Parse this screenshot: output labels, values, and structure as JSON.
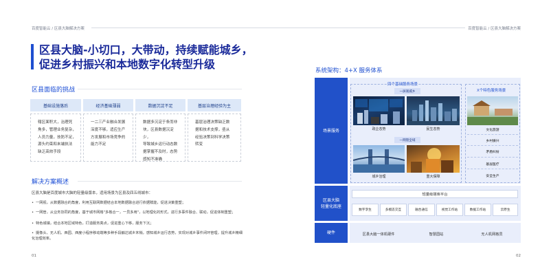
{
  "header": {
    "left": "百度智能云 / 区县大脑解决方案",
    "right": "百度智能云 / 区县大脑解决方案"
  },
  "title": {
    "line1": "区县大脑-小切口，大带动，持续赋能城乡，",
    "line2": "促进乡村振兴和本地数字化转型升级"
  },
  "challenges": {
    "title": "区县面临的挑战",
    "items": [
      {
        "head": "基础设施落后",
        "body": [
          "辖区面积大，治理死",
          "角多，管理业务复杂，",
          "人员力量，技防不足，",
          "源头约束和末端执法",
          "缺乏高效手段"
        ]
      },
      {
        "head": "经济基础薄弱",
        "body": [
          "一二三产业融合发展",
          "深度不够，适应生产",
          "方发展和市场竞争的",
          "能力不足"
        ]
      },
      {
        "head": "数据沉淀不足",
        "body": [
          "数据多沉淀于条而非",
          "块，区县数据沉淀少，",
          "导致城乡运行动态数",
          "据掌握不及时，态势",
          "感知不准确"
        ]
      },
      {
        "head": "基层治理经验为主",
        "body": [
          "基层治理决策缺乏数",
          "据和技术支撑，亟从",
          "经验决策到科学决策",
          "转变"
        ]
      }
    ]
  },
  "solution": {
    "title": "解决方案概述",
    "intro": "区县大脑是百度城市大脑的轻量级版本，适用场景为区县及四五线城市：",
    "bullets": [
      "一网视，从数据融合的角度，利用互联网数据结合本地数据融合进行依据赋能，促进决策重塑；",
      "一网管，从业务协同的角度，基于城市网格\"多格合一，一员多用\"，以地理化的形式，进行多事件融合、联动，促进体制重塑；",
      "特色城镇，结合本地区域特色，打造服务亮点，促进重心下移，服务下沉；",
      "摄像头、无人机、西园、西度小程序移动端等多种手段触达城乡末梢，感知城乡运行态势，实现对城乡事件闭环管理，提升城乡精细化治理效率。"
    ]
  },
  "page_numbers": {
    "left": "01",
    "right": "02"
  },
  "architecture": {
    "title": "系统架构：4+X 服务体系",
    "layers": {
      "scene": "场景服务",
      "brain": "区县大脑\n轻量化底座",
      "hardware": "硬件"
    },
    "four_title": "四个基础服务场景",
    "yiwang_guan": "一屏观城乡",
    "yiwang_guan2": "一网管全域",
    "four_captions": [
      "政企态势",
      "民生态势",
      "城乡治理",
      "重大保障"
    ],
    "x_title": "X个特色服务场景",
    "x_items": [
      "文化旅游",
      "乡村振兴",
      "矛盾纠纷",
      "基层医疗",
      "安全生产"
    ],
    "platform": "轻量级搭库平台",
    "tools": [
      "数字孪生",
      "多模态交互",
      "融合通信",
      "视觉工作站",
      "数据工作站",
      "云原生"
    ],
    "hardware_items": [
      "区县大脑一体机硬件",
      "智慧园站",
      "无人机网格员"
    ]
  },
  "colors": {
    "brand": "#1e4fd0",
    "title": "#1a2a9a",
    "panel": "#e9eefb",
    "layer": "#2151c9"
  }
}
